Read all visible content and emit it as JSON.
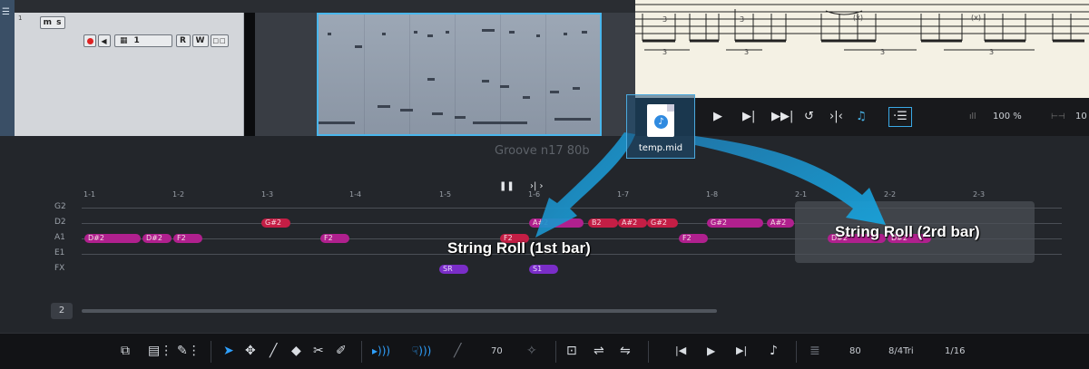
{
  "menu": {
    "icon": "menu-icon"
  },
  "track": {
    "index": "1",
    "mute_solo": "m s",
    "channel": "1",
    "r_label": "R",
    "w_label": "W",
    "lanes_glyph": "□□"
  },
  "score_bar": {
    "zoom": "100 %",
    "zoom2": "10"
  },
  "file": {
    "name": "temp.mid"
  },
  "roll": {
    "title": "Groove n17 80b",
    "ruler": [
      "1-1",
      "1-2",
      "1-3",
      "1-4",
      "1-5",
      "1-6",
      "1-7",
      "1-8",
      "2-1",
      "2-2",
      "2-3"
    ],
    "strings": [
      "G2",
      "D2",
      "A1",
      "E1",
      "FX"
    ],
    "notes_d2": [
      "G#2",
      "A#2",
      "B2",
      "A#2",
      "G#2",
      "G#2",
      "A#2"
    ],
    "notes_a1": [
      "D#2",
      "D#2",
      "F2",
      "F2",
      "F2",
      "F2",
      "D#2",
      "D#2"
    ],
    "notes_fx": [
      "SR",
      "S1"
    ],
    "annotation_1": "String Roll (1st bar)",
    "annotation_2": "String Roll (2rd bar)",
    "page": "2"
  },
  "toolbar": {
    "velocity": "70",
    "tempo": "80",
    "time_sig": "8/4Tri",
    "quantize": "1/16"
  },
  "colors": {
    "accent": "#49b6ec",
    "note_red": "#c41e45",
    "note_magenta": "#b0208e",
    "note_purple": "#7a2dc8"
  }
}
